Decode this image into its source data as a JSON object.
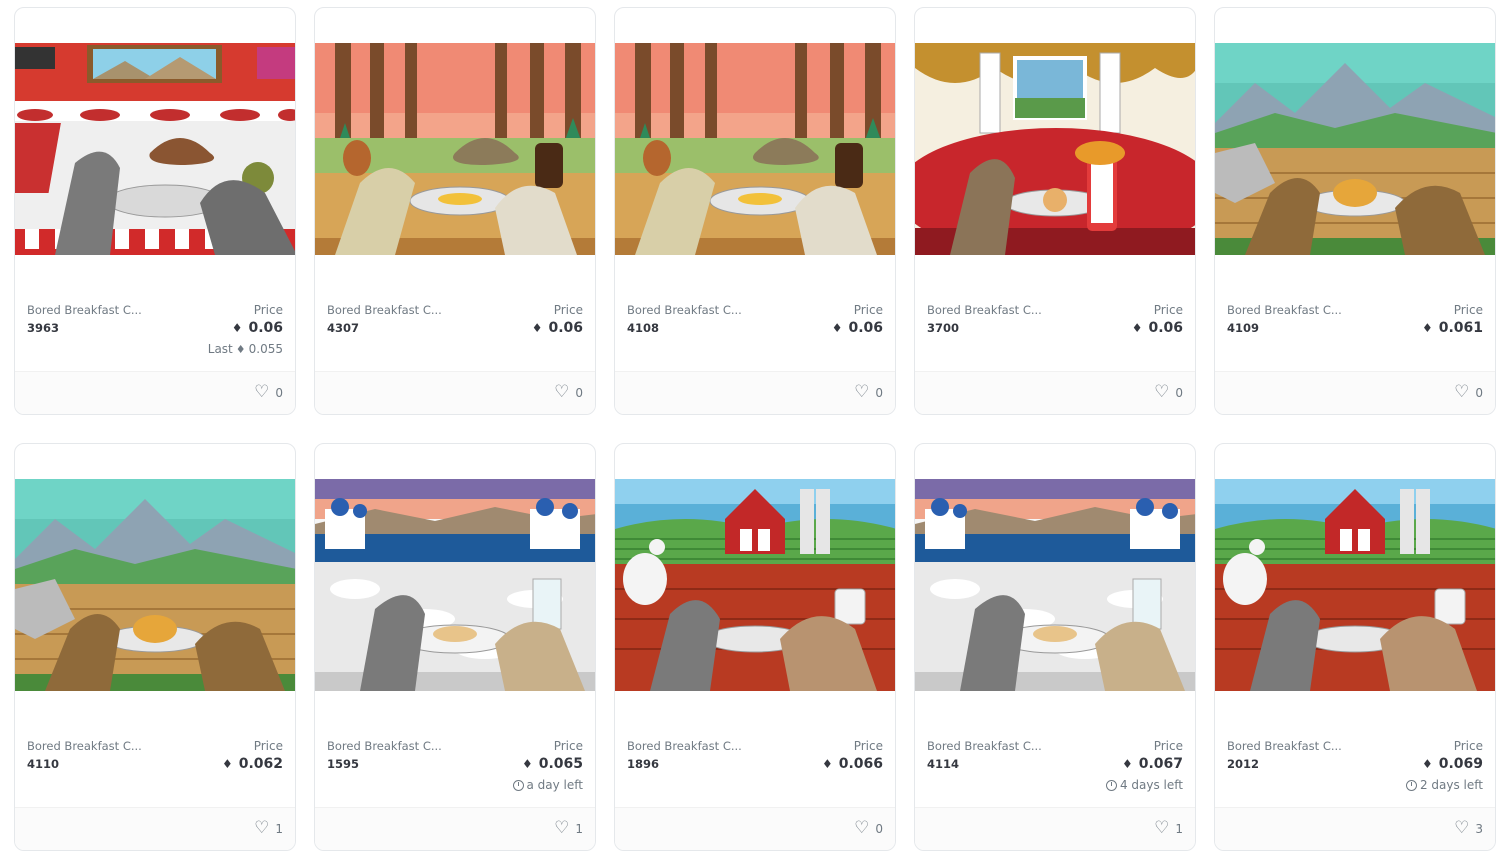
{
  "cards": [
    {
      "name": "Bored Breakfast C...",
      "token": "3963",
      "price_label": "Price",
      "eth_icon": "ethereum-icon",
      "price": "0.06",
      "last_label": "Last",
      "last_price": "0.055",
      "likes": "0",
      "scene": "diner"
    },
    {
      "name": "Bored Breakfast C...",
      "token": "4307",
      "price_label": "Price",
      "eth_icon": "ethereum-icon",
      "price": "0.06",
      "likes": "0",
      "scene": "forest"
    },
    {
      "name": "Bored Breakfast C...",
      "token": "4108",
      "price_label": "Price",
      "eth_icon": "ethereum-icon",
      "price": "0.06",
      "likes": "0",
      "scene": "forest"
    },
    {
      "name": "Bored Breakfast C...",
      "token": "3700",
      "price_label": "Price",
      "eth_icon": "ethereum-icon",
      "price": "0.06",
      "likes": "0",
      "scene": "palace"
    },
    {
      "name": "Bored Breakfast C...",
      "token": "4109",
      "price_label": "Price",
      "eth_icon": "ethereum-icon",
      "price": "0.061",
      "likes": "0",
      "scene": "mountain"
    },
    {
      "name": "Bored Breakfast C...",
      "token": "4110",
      "price_label": "Price",
      "eth_icon": "ethereum-icon",
      "price": "0.062",
      "likes": "1",
      "scene": "mountain"
    },
    {
      "name": "Bored Breakfast C...",
      "token": "1595",
      "price_label": "Price",
      "eth_icon": "ethereum-icon",
      "price": "0.065",
      "time_left": "a day left",
      "likes": "1",
      "scene": "greek"
    },
    {
      "name": "Bored Breakfast C...",
      "token": "1896",
      "price_label": "Price",
      "eth_icon": "ethereum-icon",
      "price": "0.066",
      "likes": "0",
      "scene": "farm"
    },
    {
      "name": "Bored Breakfast C...",
      "token": "4114",
      "price_label": "Price",
      "eth_icon": "ethereum-icon",
      "price": "0.067",
      "time_left": "4 days left",
      "likes": "1",
      "scene": "greek"
    },
    {
      "name": "Bored Breakfast C...",
      "token": "2012",
      "price_label": "Price",
      "eth_icon": "ethereum-icon",
      "price": "0.069",
      "time_left": "2 days left",
      "likes": "3",
      "scene": "farm"
    }
  ],
  "colors": {
    "text_primary": "#353840",
    "text_secondary": "#707a83",
    "border": "#e5e8eb"
  }
}
